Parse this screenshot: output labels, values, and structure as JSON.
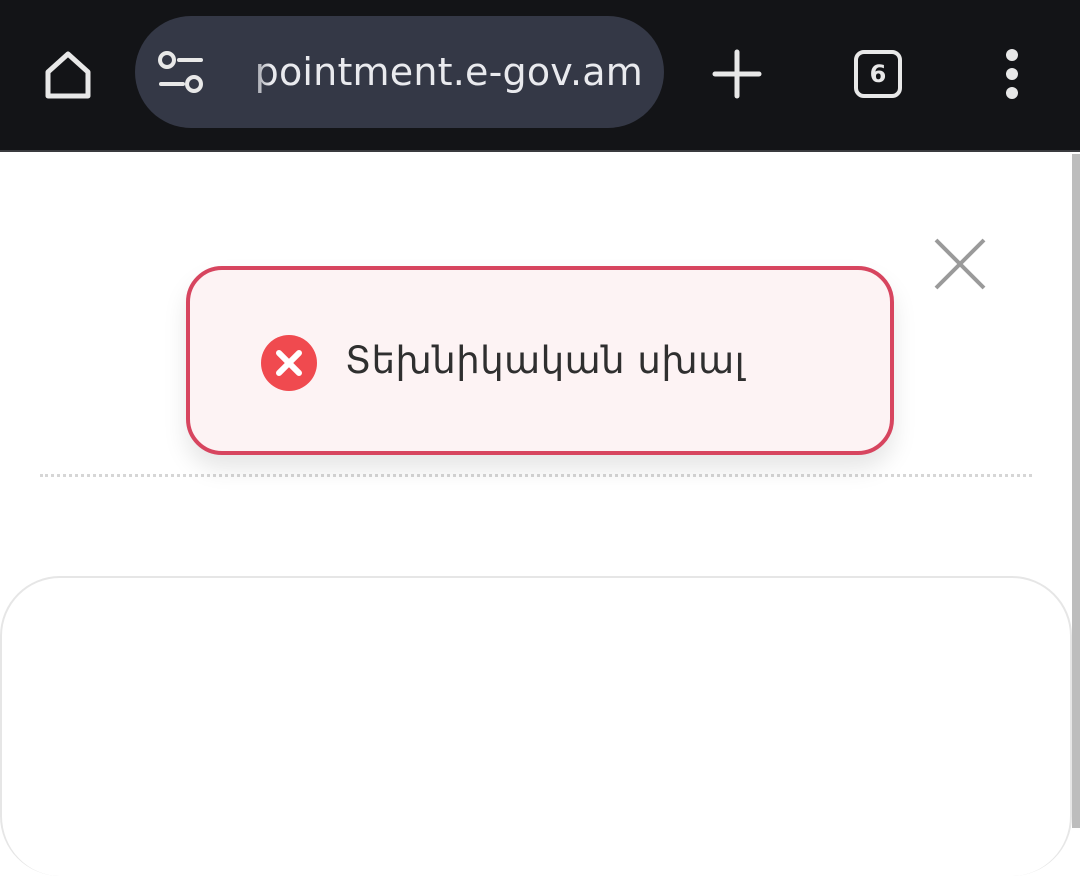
{
  "browser": {
    "url_display": "pointment.e-gov.am",
    "tab_count": "6",
    "icons": {
      "home": "home-icon",
      "site_settings": "site-settings-icon",
      "new_tab": "plus-icon",
      "tabs": "tab-switcher-icon",
      "menu": "more-vertical-icon"
    }
  },
  "page": {
    "close_icon": "close-icon"
  },
  "toast": {
    "message": "Տեխնիկական սխալ",
    "icon": "error-circle-icon",
    "colors": {
      "border": "#d7455f",
      "background": "#fdf3f4",
      "icon": "#f04a4f"
    }
  }
}
